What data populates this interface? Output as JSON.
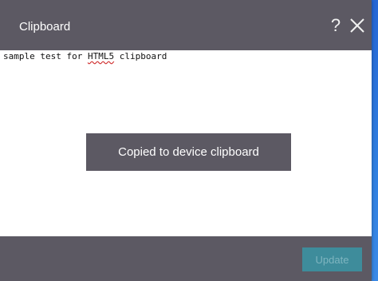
{
  "dialog": {
    "title": "Clipboard",
    "help_label": "?",
    "icons": {
      "help": "help-icon",
      "close": "close-icon"
    }
  },
  "content": {
    "text_before": "sample test for ",
    "text_flagged": "HTML5",
    "text_after": " clipboard"
  },
  "toast": {
    "message": "Copied to device clipboard"
  },
  "footer": {
    "update_label": "Update",
    "update_state": "disabled"
  },
  "colors": {
    "chrome": "#5c5963",
    "button_disabled": "#3e8c9b",
    "desktop": "#2f6fd4"
  }
}
